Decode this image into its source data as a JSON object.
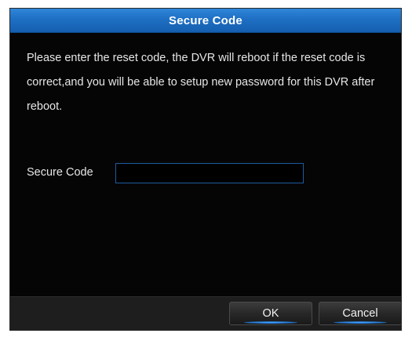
{
  "dialog": {
    "title": "Secure Code",
    "message": "Please enter the reset code, the DVR will reboot if the reset code is correct,and you will be able to setup new password for this DVR after reboot.",
    "code_field": {
      "label": "Secure Code",
      "value": "",
      "placeholder": ""
    },
    "buttons": {
      "ok_label": "OK",
      "cancel_label": "Cancel"
    }
  },
  "colors": {
    "titlebar_blue": "#1e6fc4",
    "background": "#050505",
    "input_border": "#1d5c9e"
  }
}
